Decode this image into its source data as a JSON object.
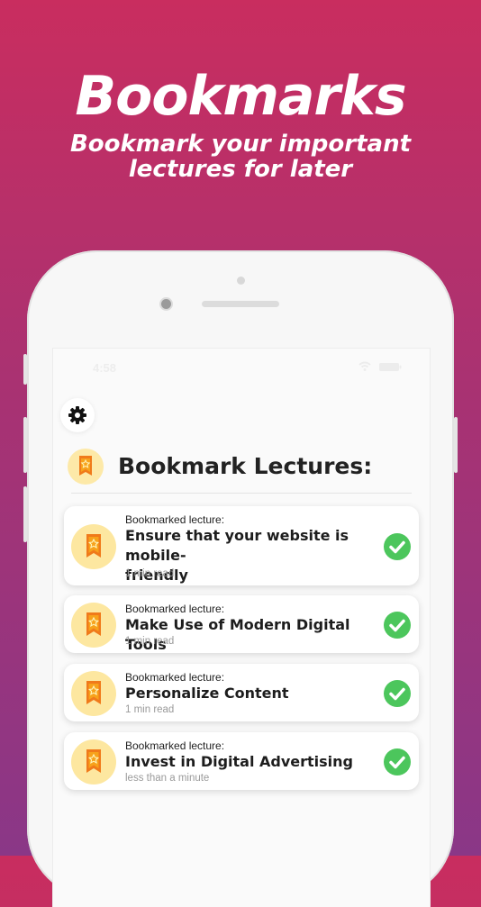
{
  "headline": "Bookmarks",
  "subheadline_line1": "Bookmark your important",
  "subheadline_line2": "lectures for later",
  "status_bar": {
    "time": "4:58"
  },
  "page": {
    "heading": "Bookmark Lectures:"
  },
  "colors": {
    "accent_green": "#4cc65c",
    "badge_orange": "#f07a1a",
    "badge_bg": "#fde7a0"
  },
  "lectures": [
    {
      "label": "Bookmarked lecture:",
      "title_line1": "Ensure that your website is mobile-",
      "title_line2": "friendly",
      "meta": "1 min read"
    },
    {
      "label": "Bookmarked lecture:",
      "title_line1": "Make Use of Modern Digital Tools",
      "title_line2": "",
      "meta": "1 min read"
    },
    {
      "label": "Bookmarked lecture:",
      "title_line1": "Personalize Content",
      "title_line2": "",
      "meta": "1 min read"
    },
    {
      "label": "Bookmarked lecture:",
      "title_line1": "Invest in Digital Advertising",
      "title_line2": "",
      "meta": "less than a minute"
    }
  ]
}
